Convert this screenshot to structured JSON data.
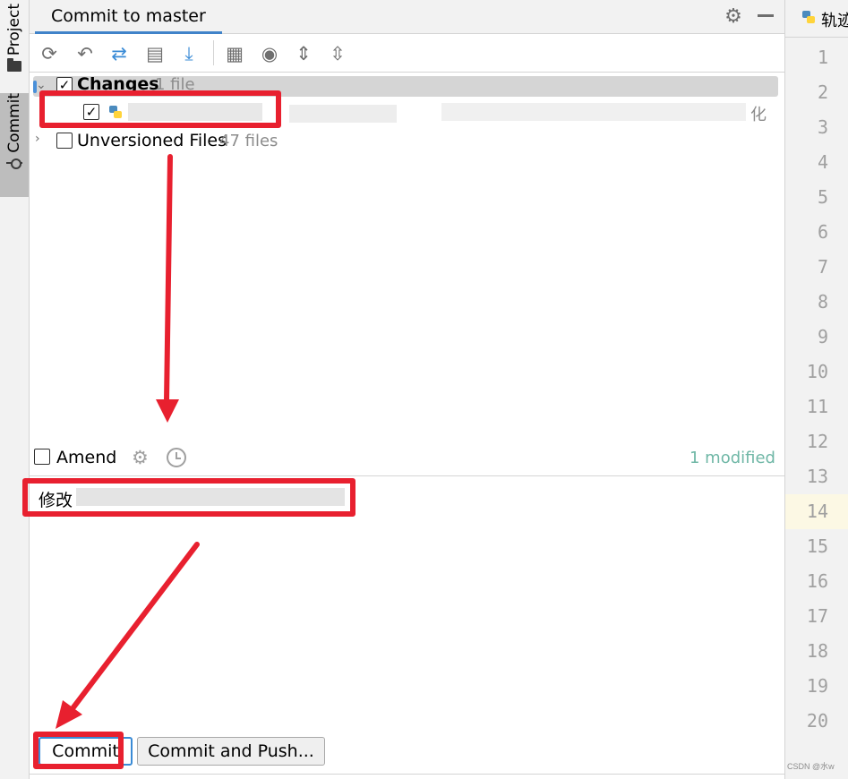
{
  "left_strip": {
    "project_label": "Project",
    "commit_label": "Commit"
  },
  "header": {
    "tab_label": "Commit to master",
    "gear_icon": "gear-icon",
    "minimize_icon": "minimize-icon"
  },
  "toolbar": {
    "icons": [
      "refresh-icon",
      "rollback-icon",
      "diff-icon",
      "changelist-icon",
      "shelve-icon",
      "group-by-icon",
      "view-options-icon",
      "expand-all-icon",
      "collapse-all-icon"
    ]
  },
  "tree": {
    "changes_label": "Changes",
    "changes_count": "1 file",
    "file_trailing": "化",
    "unversioned_label": "Unversioned Files",
    "unversioned_count": "47 files"
  },
  "amend": {
    "label": "Amend",
    "modified_count": "1 modified"
  },
  "message": {
    "text": "修改"
  },
  "buttons": {
    "commit": "Commit",
    "commit_and_push": "Commit and Push..."
  },
  "editor": {
    "tab_label": "轨迹",
    "line_numbers": [
      "1",
      "2",
      "3",
      "4",
      "5",
      "6",
      "7",
      "8",
      "9",
      "10",
      "11",
      "12",
      "13",
      "14",
      "15",
      "16",
      "17",
      "18",
      "19",
      "20"
    ],
    "current_line": "14",
    "watermark": "CSDN @水w"
  },
  "colors": {
    "accent_blue": "#4083c9",
    "annotation_red": "#e8202f",
    "modified_teal": "#6fb7a6"
  }
}
